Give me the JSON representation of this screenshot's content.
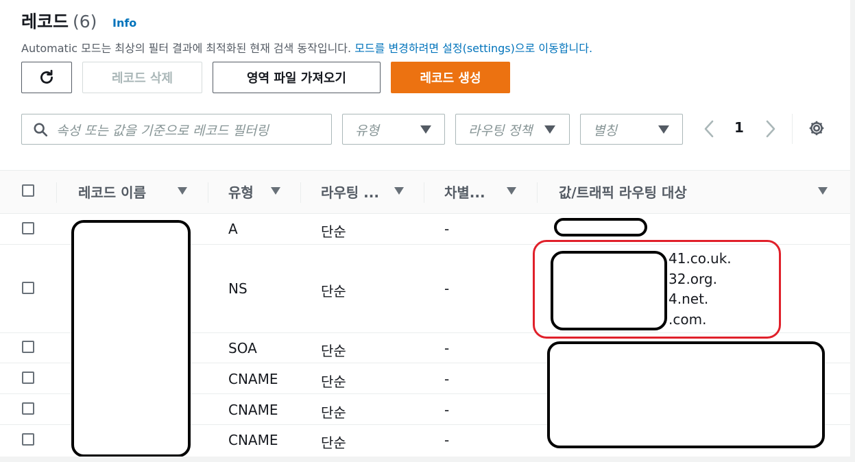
{
  "header": {
    "title": "레코드",
    "count": "(6)",
    "info_link": "Info",
    "description_text": "Automatic 모드는 최상의 필터 결과에 최적화된 현재 검색 동작입니다.",
    "description_link": "모드를 변경하려면 설정(settings)으로 이동합니다."
  },
  "toolbar": {
    "refresh_icon": "refresh-icon",
    "delete_label": "레코드 삭제",
    "import_label": "영역 파일 가져오기",
    "create_label": "레코드 생성"
  },
  "filters": {
    "search_placeholder": "속성 또는 값을 기준으로 레코드 필터링",
    "type_placeholder": "유형",
    "routing_placeholder": "라우팅 정책",
    "alias_placeholder": "별칭"
  },
  "pagination": {
    "current_page": "1"
  },
  "table": {
    "columns": [
      "레코드 이름",
      "유형",
      "라우팅 ...",
      "차별...",
      "값/트래픽 라우팅 대상"
    ],
    "rows": [
      {
        "type": "A",
        "routing": "단순",
        "differentiator": "-",
        "value_lines": []
      },
      {
        "type": "NS",
        "routing": "단순",
        "differentiator": "-",
        "value_lines": [
          "41.co.uk.",
          "32.org.",
          "4.net.",
          ".com."
        ]
      },
      {
        "type": "SOA",
        "routing": "단순",
        "differentiator": "-",
        "value_lines": []
      },
      {
        "type": "CNAME",
        "routing": "단순",
        "differentiator": "-",
        "value_lines": []
      },
      {
        "type": "CNAME",
        "routing": "단순",
        "differentiator": "-",
        "value_lines": []
      },
      {
        "type": "CNAME",
        "routing": "단순",
        "differentiator": "-",
        "value_lines": []
      }
    ]
  },
  "colors": {
    "primary": "#ec7211",
    "link": "#0073bb",
    "highlight": "#e0202a"
  }
}
